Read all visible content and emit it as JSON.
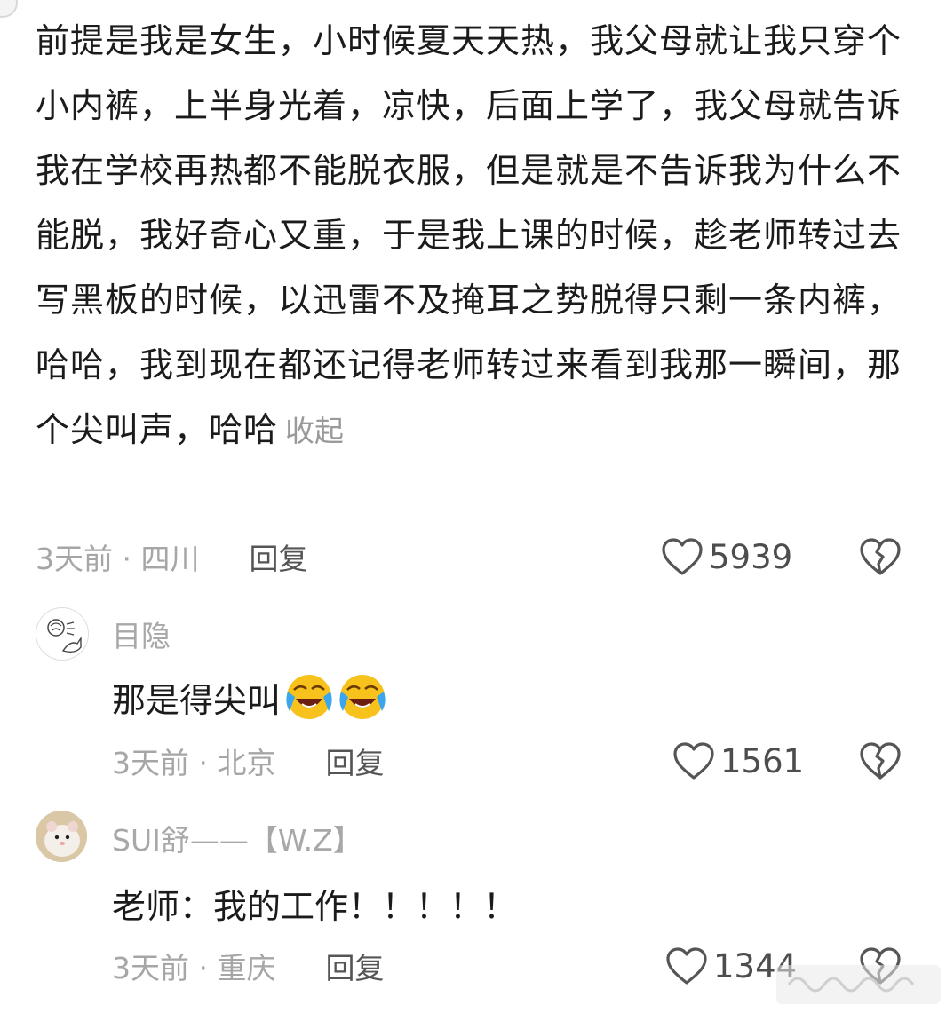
{
  "main_comment": {
    "text": "前提是我是女生，小时候夏天天热，我父母就让我只穿个小内裤，上半身光着，凉快，后面上学了，我父母就告诉我在学校再热都不能脱衣服，但是就是不告诉我为什么不能脱，我好奇心又重，于是我上课的时候，趁老师转过去写黑板的时候，以迅雷不及掩耳之势脱得只剩一条内裤，哈哈，我到现在都还记得老师转过来看到我那一瞬间，那个尖叫声，哈哈",
    "collapse_label": "收起",
    "time_location": "3天前 · 四川",
    "reply_label": "回复",
    "likes": "5939"
  },
  "replies": [
    {
      "username": "目隐",
      "text": "那是得尖叫",
      "emoji": "crying-laughing-emoji",
      "time_location": "3天前 · 北京",
      "reply_label": "回复",
      "likes": "1561"
    },
    {
      "username": "SUI舒——【W.Z】",
      "text": "老师：我的工作！！！！！",
      "time_location": "3天前 · 重庆",
      "reply_label": "回复",
      "likes": "1344"
    }
  ],
  "icons": [
    "heart-icon",
    "broken-heart-icon",
    "crying-laughing-emoji"
  ],
  "colors": {
    "text": "#1b1b1b",
    "meta": "#a6a6a6",
    "reply_link": "#555555",
    "icon": "#555555"
  }
}
